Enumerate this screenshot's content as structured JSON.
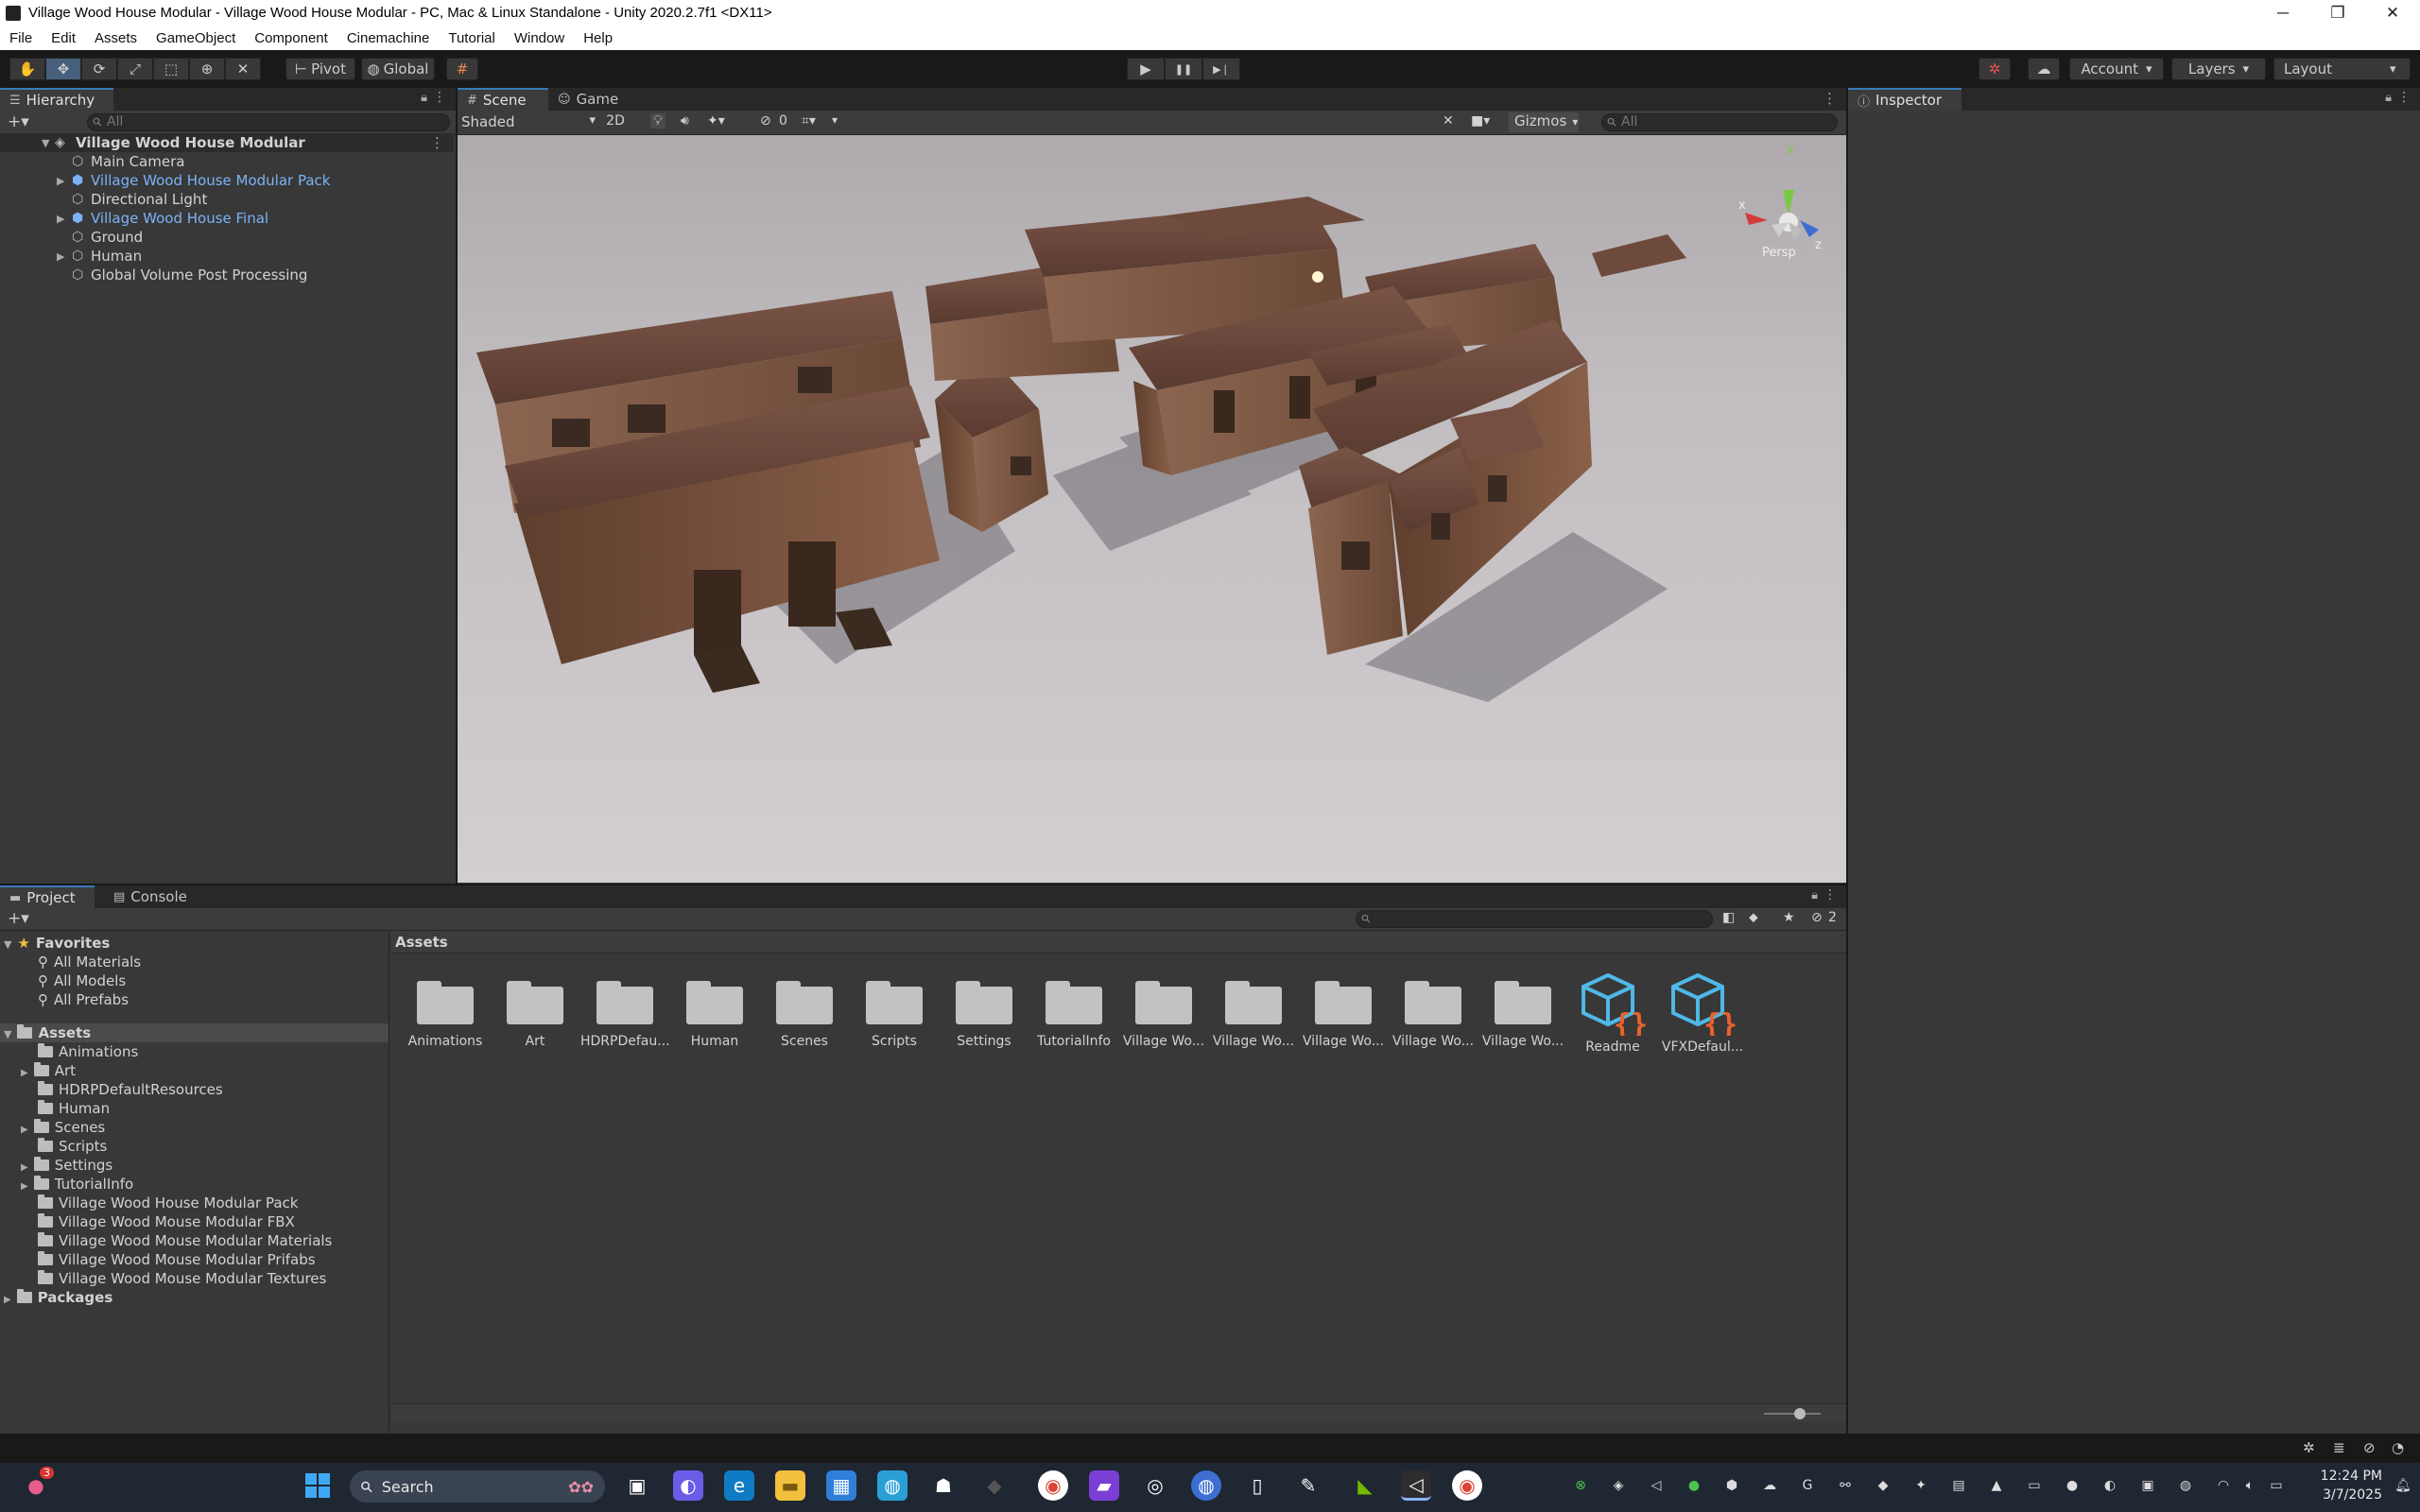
{
  "window": {
    "title": "Village Wood House Modular - Village Wood House Modular - PC, Mac & Linux Standalone - Unity 2020.2.7f1 <DX11>",
    "min": "─",
    "max": "❐",
    "close": "✕"
  },
  "menu": [
    "File",
    "Edit",
    "Assets",
    "GameObject",
    "Component",
    "Cinemachine",
    "Tutorial",
    "Window",
    "Help"
  ],
  "toolbar": {
    "pivot": "Pivot",
    "global": "Global",
    "account": "Account",
    "layers": "Layers",
    "layout": "Layout",
    "play_icon": "▶",
    "pause_icon": "❚❚",
    "step_icon": "▶❘"
  },
  "hierarchy": {
    "tab": "Hierarchy",
    "search_placeholder": "All",
    "scene": "Village Wood House Modular",
    "items": [
      {
        "label": "Main Camera",
        "prefab": false,
        "expandable": false
      },
      {
        "label": "Village Wood House Modular Pack",
        "prefab": true,
        "expandable": true
      },
      {
        "label": "Directional Light",
        "prefab": false,
        "expandable": false
      },
      {
        "label": "Village Wood House Final",
        "prefab": true,
        "expandable": true
      },
      {
        "label": "Ground",
        "prefab": false,
        "expandable": false
      },
      {
        "label": "Human",
        "prefab": false,
        "expandable": true
      },
      {
        "label": "Global Volume Post Processing",
        "prefab": false,
        "expandable": false
      }
    ]
  },
  "scene_view": {
    "tab_scene": "Scene",
    "tab_game": "Game",
    "shading": "Shaded",
    "mode_2d": "2D",
    "hidden_count": "0",
    "gizmos": "Gizmos",
    "search_placeholder": "All",
    "persp": "Persp",
    "axis_y": "y",
    "axis_x": "x",
    "axis_z": "z"
  },
  "inspector": {
    "tab": "Inspector"
  },
  "project": {
    "tab_project": "Project",
    "tab_console": "Console",
    "favorites_label": "Favorites",
    "favorites": [
      "All Materials",
      "All Models",
      "All Prefabs"
    ],
    "assets_label": "Assets",
    "asset_folders": [
      {
        "label": "Animations",
        "expandable": false
      },
      {
        "label": "Art",
        "expandable": true
      },
      {
        "label": "HDRPDefaultResources",
        "expandable": false
      },
      {
        "label": "Human",
        "expandable": false
      },
      {
        "label": "Scenes",
        "expandable": true
      },
      {
        "label": "Scripts",
        "expandable": false
      },
      {
        "label": "Settings",
        "expandable": true
      },
      {
        "label": "TutorialInfo",
        "expandable": true
      },
      {
        "label": "Village Wood House Modular Pack",
        "expandable": false
      },
      {
        "label": "Village Wood Mouse Modular FBX",
        "expandable": false
      },
      {
        "label": "Village Wood Mouse Modular Materials",
        "expandable": false
      },
      {
        "label": "Village Wood Mouse Modular Prifabs",
        "expandable": false
      },
      {
        "label": "Village Wood Mouse Modular Textures",
        "expandable": false
      }
    ],
    "packages_label": "Packages",
    "breadcrumb": "Assets",
    "hidden_packages_count": "2",
    "grid": [
      {
        "label": "Animations",
        "kind": "folder"
      },
      {
        "label": "Art",
        "kind": "folder"
      },
      {
        "label": "HDRPDefau...",
        "kind": "folder"
      },
      {
        "label": "Human",
        "kind": "folder"
      },
      {
        "label": "Scenes",
        "kind": "folder"
      },
      {
        "label": "Scripts",
        "kind": "folder"
      },
      {
        "label": "Settings",
        "kind": "folder"
      },
      {
        "label": "TutorialInfo",
        "kind": "folder"
      },
      {
        "label": "Village Wo...",
        "kind": "folder"
      },
      {
        "label": "Village Wo...",
        "kind": "folder"
      },
      {
        "label": "Village Wo...",
        "kind": "folder"
      },
      {
        "label": "Village Wo...",
        "kind": "folder"
      },
      {
        "label": "Village Wo...",
        "kind": "folder"
      },
      {
        "label": "Readme",
        "kind": "asset"
      },
      {
        "label": "VFXDefaul...",
        "kind": "asset"
      }
    ]
  },
  "taskbar": {
    "search_label": "Search",
    "time": "12:24 PM",
    "date": "3/7/2025",
    "notification_count": "3"
  }
}
